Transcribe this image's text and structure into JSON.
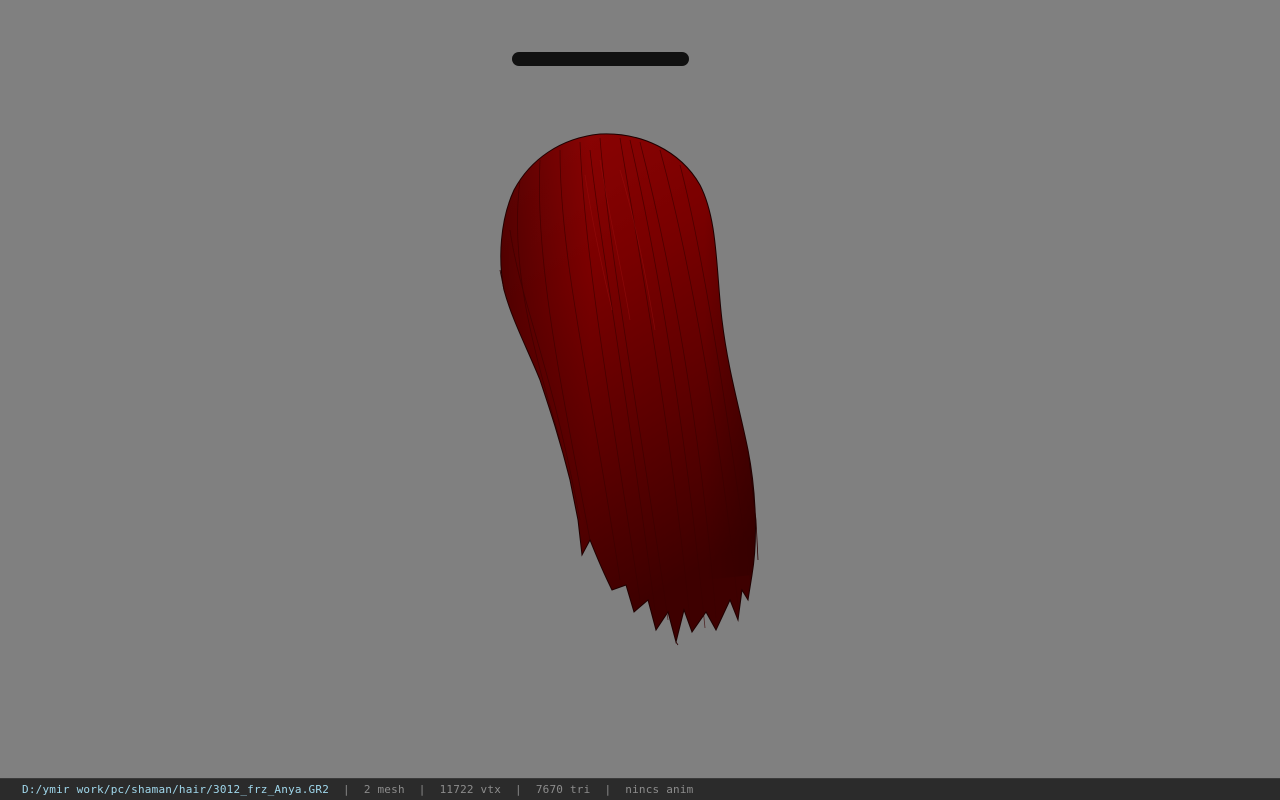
{
  "viewport": {
    "background_color": "#808080",
    "hair_color": "#7a0000",
    "bone_bar_color": "#111111",
    "model_icon": "hair-mesh-icon"
  },
  "statusbar": {
    "file_path": "D:/ymir work/pc/shaman/hair/3012_frz_Anya.GR2",
    "separator": "|",
    "mesh_count": "2 mesh",
    "vertex_count": "11722 vtx",
    "triangle_count": "7670 tri",
    "anim_status": "nincs anim",
    "path_color": "#9fd6ea",
    "text_color": "#8c8c8c"
  }
}
